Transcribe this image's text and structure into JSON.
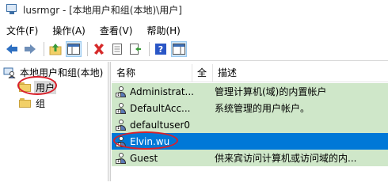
{
  "window": {
    "title": "lusrmgr - [本地用户和组(本地)\\用户]"
  },
  "menu": [
    "文件(F)",
    "操作(A)",
    "查看(V)",
    "帮助(H)"
  ],
  "toolbar": {
    "buttons": [
      "back-arrow-icon",
      "forward-arrow-icon",
      "up-folder-icon",
      "show-tree-icon",
      "delete-icon",
      "properties-icon",
      "export-icon",
      "help-icon",
      "action-pane-icon"
    ]
  },
  "tree": {
    "root": "本地用户和组(本地)",
    "items": [
      {
        "label": "用户",
        "selected": true
      },
      {
        "label": "组",
        "selected": false
      }
    ]
  },
  "list": {
    "columns": [
      "名称",
      "全",
      "描述"
    ],
    "rows": [
      {
        "name": "Administrat...",
        "desc": "管理计算机(域)的内置帐户",
        "selected": false
      },
      {
        "name": "DefaultAcc...",
        "desc": "系统管理的用户帐户。",
        "selected": false
      },
      {
        "name": "defaultuser0",
        "desc": "",
        "selected": false
      },
      {
        "name": "Elvin.wu",
        "desc": "",
        "selected": true
      },
      {
        "name": "Guest",
        "desc": "供来宾访问计算机或访问域的内...",
        "selected": false
      }
    ]
  },
  "colors": {
    "selection": "#0078d7",
    "row_highlight": "#cfe7c9",
    "annotation": "#d9202a"
  }
}
